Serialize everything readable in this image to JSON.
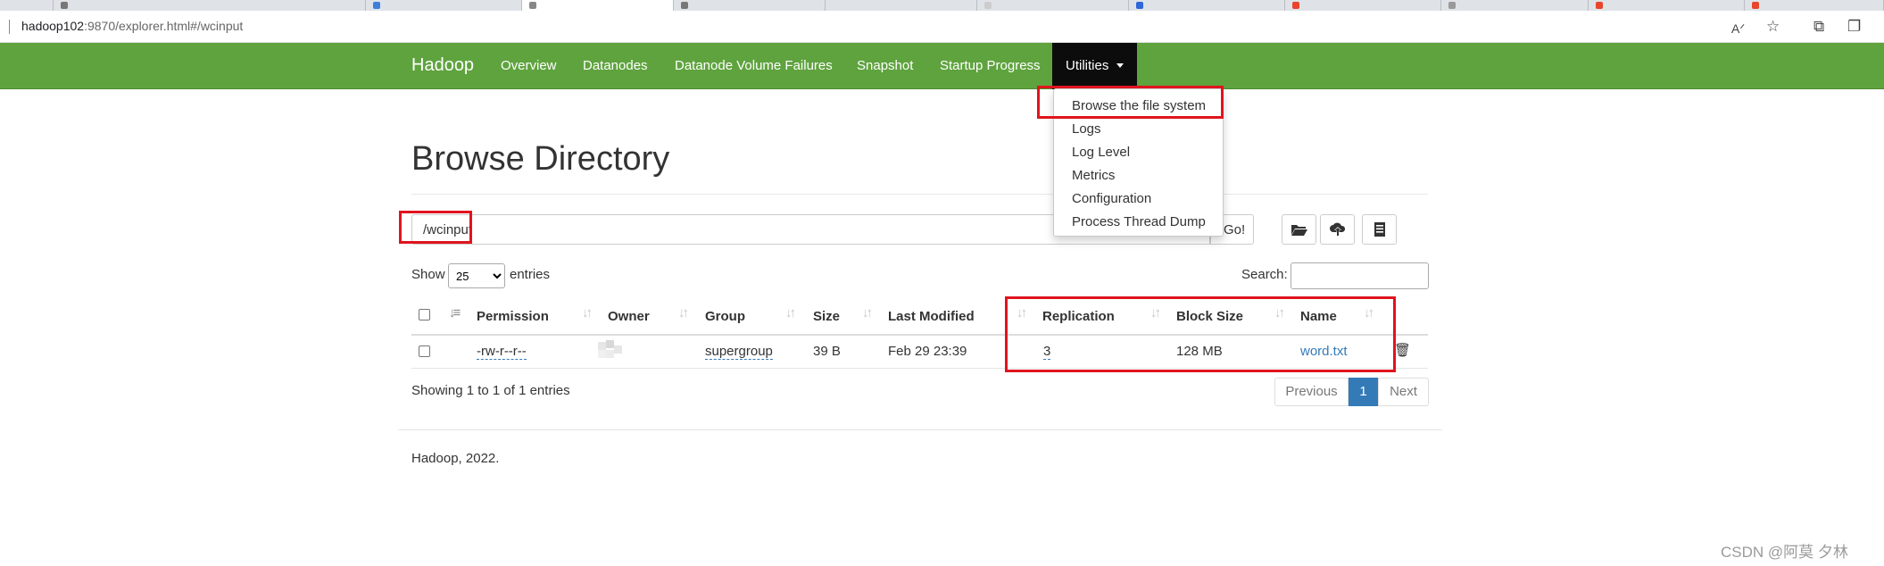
{
  "browser": {
    "url_host": "hadoop102",
    "url_rest": ":9870/explorer.html#/wcinput"
  },
  "navbar": {
    "brand": "Hadoop",
    "links": [
      "Overview",
      "Datanodes",
      "Datanode Volume Failures",
      "Snapshot",
      "Startup Progress"
    ],
    "utilities_label": "Utilities"
  },
  "utilities_menu": {
    "items": [
      "Browse the file system",
      "Logs",
      "Log Level",
      "Metrics",
      "Configuration",
      "Process Thread Dump"
    ]
  },
  "page": {
    "title": "Browse Directory",
    "path_value": "/wcinput",
    "go_label": "Go!"
  },
  "table_controls": {
    "show_label": "Show",
    "entries_value": "25",
    "entries_label": "entries",
    "search_label": "Search:"
  },
  "table": {
    "columns": [
      "Permission",
      "Owner",
      "Group",
      "Size",
      "Last Modified",
      "Replication",
      "Block Size",
      "Name"
    ],
    "rows": [
      {
        "permission": "-rw-r--r--",
        "owner": "",
        "group": "supergroup",
        "size": "39 B",
        "last_modified": "Feb 29 23:39",
        "replication": "3",
        "block_size": "128 MB",
        "name": "word.txt"
      }
    ]
  },
  "pagination": {
    "info": "Showing 1 to 1 of 1 entries",
    "previous": "Previous",
    "current": "1",
    "next": "Next"
  },
  "footer": {
    "text": "Hadoop, 2022."
  },
  "watermark": "CSDN @阿莫 夕林",
  "colors": {
    "navbar": "#5fa33e",
    "active_nav": "#0c0c0c",
    "link": "#337ab7",
    "highlight": "#e0141e"
  }
}
